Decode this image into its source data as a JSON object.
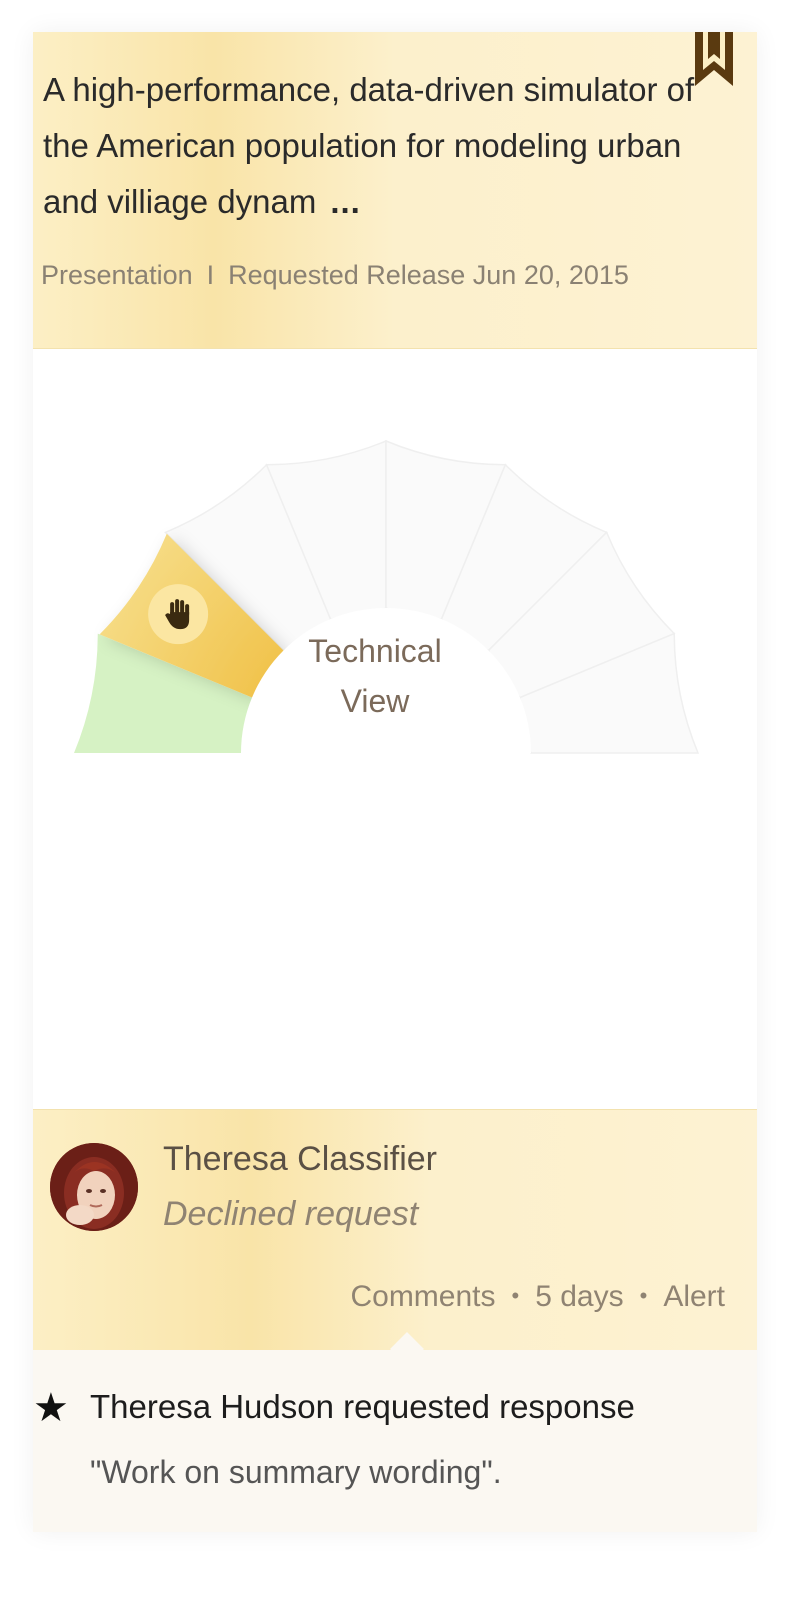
{
  "header": {
    "title": "A high-performance, data-driven simulator of the American population for modeling urban and villiage dynam",
    "ellipsis": "...",
    "type": "Presentation",
    "separator": "I",
    "release": "Requested Release Jun 20, 2015",
    "bookmark_icon": "bookmark-icon"
  },
  "gauge": {
    "label_line1": "Technical",
    "label_line2": "View",
    "segments_total": 8,
    "green_segments": 1,
    "active_segment": 2,
    "active_icon": "hand-stop-icon",
    "colors": {
      "green": "#d6f2c4",
      "active": "#f3cf6a",
      "inactive": "#fafafa",
      "marker": "#fbe6a2"
    }
  },
  "activity": {
    "user_name": "Theresa Classifier",
    "action": "Declined request",
    "links": {
      "comments": "Comments",
      "age": "5 days",
      "alert": "Alert"
    }
  },
  "comment": {
    "star_icon": "star-icon",
    "title": "Theresa Hudson requested response",
    "body": "\"Work on summary wording\"."
  }
}
